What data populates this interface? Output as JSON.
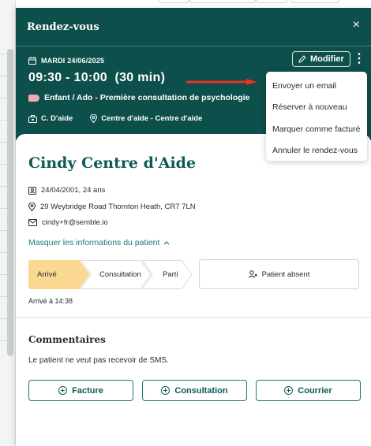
{
  "panel": {
    "title": "Rendez-vous",
    "close_icon": "×"
  },
  "appointment": {
    "date": "MARDI 24/06/2025",
    "time": "09:30 - 10:00",
    "duration": "(30 min)",
    "type": "Enfant / Ado - Première consultation de psychologie",
    "practitioner": "C. D'aide",
    "location": "Centre d'aide - Centre d'aide",
    "tag_color": "#f0a9b5"
  },
  "toolbar": {
    "modify_label": "Modifier",
    "more_icon": "⋮"
  },
  "menu": {
    "items": [
      "Envoyer un email",
      "Réserver à nouveau",
      "Marquer comme facturé",
      "Annuler le rendez-vous"
    ]
  },
  "patient": {
    "name": "Cindy Centre d'Aide",
    "dob": "24/04/2001, 24 ans",
    "address": "29 Weybridge Road Thornton Heath, CR7 7LN",
    "email": "cindy+fr@semble.io",
    "hide_link": "Masquer les informations du patient"
  },
  "status": {
    "steps": [
      "Arrivé",
      "Consultation",
      "Parti"
    ],
    "active_step": "Arrivé",
    "absent_label": "Patient absent",
    "arrived_at": "Arrivé à 14:38"
  },
  "comments": {
    "title": "Commentaires",
    "text": "Le patient ne veut pas recevoir de SMS."
  },
  "actions": {
    "invoice": "Facture",
    "consultation": "Consultation",
    "letter": "Courrier"
  },
  "colors": {
    "header": "#0d4f4b",
    "accent": "#0d5a55",
    "active_step": "#fbd891",
    "arrow": "#e8321f"
  }
}
